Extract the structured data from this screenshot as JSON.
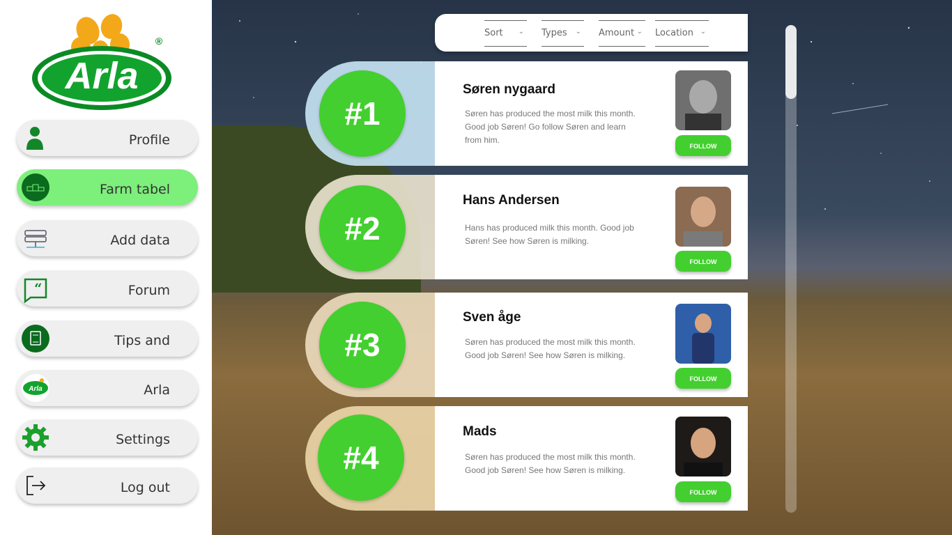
{
  "brand": {
    "logo_text": "Arla",
    "registered": "®",
    "accent": "#43cf2f",
    "nav_active": "#7def7b"
  },
  "nav": [
    {
      "label": "Profile",
      "icon": "person-icon"
    },
    {
      "label": "Farm tabel",
      "icon": "podium-icon",
      "active": true
    },
    {
      "label": "Add data",
      "icon": "server-icon"
    },
    {
      "label": "Forum",
      "icon": "quote-chat-icon"
    },
    {
      "label": "Tips and",
      "icon": "book-icon"
    },
    {
      "label": "Arla",
      "icon": "arla-logo-icon"
    },
    {
      "label": "Settings",
      "icon": "gear-icon"
    },
    {
      "label": "Log out",
      "icon": "logout-icon"
    }
  ],
  "filters": [
    {
      "label": "Sort"
    },
    {
      "label": "Types"
    },
    {
      "label": "Amount"
    },
    {
      "label": "Location"
    }
  ],
  "leaderboard": [
    {
      "rank": "#1",
      "name": "Søren nygaard",
      "desc": "Søren has produced the most milk this month. Good job Søren! Go follow Søren and learn from him.",
      "follow": "FOLLOW"
    },
    {
      "rank": "#2",
      "name": "Hans Andersen",
      "desc": "Hans has produced milk this month. Good job Søren! See how Søren is milking.",
      "follow": "FOLLOW"
    },
    {
      "rank": "#3",
      "name": "Sven åge",
      "desc": "Søren has produced the most milk this month. Good job Søren! See how Søren is milking.",
      "follow": "FOLLOW"
    },
    {
      "rank": "#4",
      "name": "Mads",
      "desc": "Søren has produced the most milk this month. Good job Søren! See how Søren is milking.",
      "follow": "FOLLOW"
    }
  ]
}
